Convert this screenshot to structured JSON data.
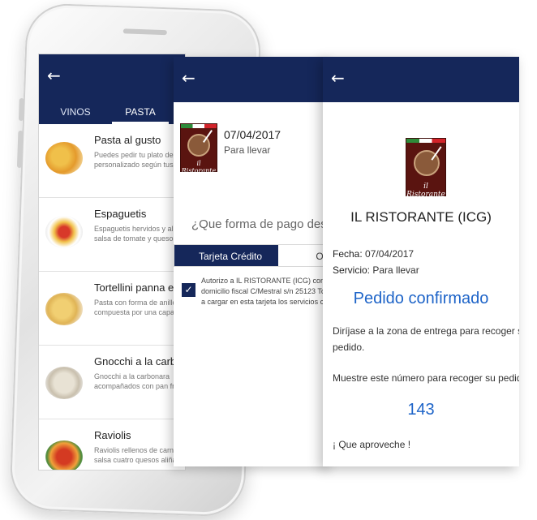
{
  "menu_screen": {
    "tabs": [
      "VINOS",
      "PASTA"
    ],
    "items": [
      {
        "title": "Pasta al gusto",
        "desc": "Puedes pedir tu plato de p\npersonalizado según tus g"
      },
      {
        "title": "Espaguetis",
        "desc": "Espaguetis hervidos y aliñ\nsalsa de tomate y queso d"
      },
      {
        "title": "Tortellini panna e p",
        "desc": "Pasta con forma de anillo,\ncompuesta por una capa c"
      },
      {
        "title": "Gnocchi a la carbo",
        "desc": "Gnocchi a la carbonara\nacompañados con pan frit"
      },
      {
        "title": "Raviolis",
        "desc": "Raviolis rellenos de carne,\nsalsa cuatro quesos aliñad"
      }
    ]
  },
  "payment_screen": {
    "date": "07/04/2017",
    "service": "Para llevar",
    "question": "¿Que forma de pago dese",
    "tab_active": "Tarjeta Crédito",
    "tab_other": "Ot",
    "consent_text": "Autorizo a IL RISTORANTE (ICG) con CIF\ndomicilio fiscal C/Mestral s/n 25123 Tor\na cargar en esta tarjeta los servicios cont"
  },
  "confirm_screen": {
    "restaurant_name": "IL RISTORANTE (ICG)",
    "date_label": "Fecha:",
    "date_value": "07/04/2017",
    "service_label": "Servicio:",
    "service_value": "Para llevar",
    "status": "Pedido confirmado",
    "instructions": "Diríjase a la zona de entrega para recoger su\npedido.",
    "number_prompt": "Muestre este número para recoger su pedido:",
    "order_number": "143",
    "farewell": "¡ Que aproveche !"
  },
  "logo_text": "il Ristorante",
  "colors": {
    "header": "#15275a",
    "accent": "#1e64c8"
  },
  "icons": {
    "back": "arrow-left-icon",
    "check": "check-icon"
  }
}
